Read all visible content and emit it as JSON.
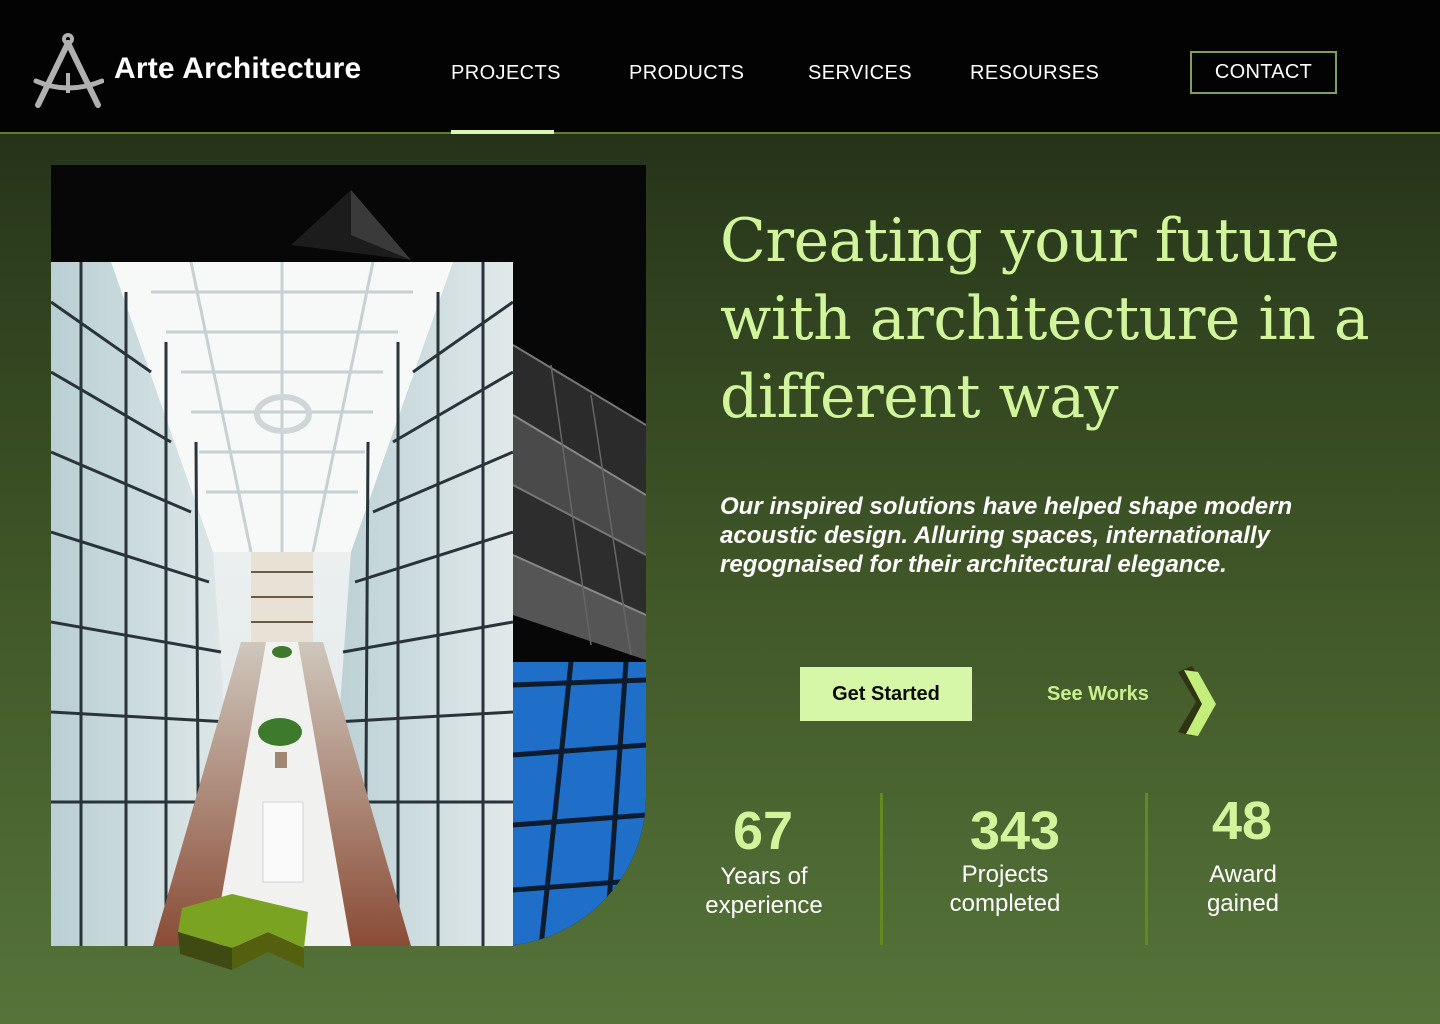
{
  "brand": {
    "name": "Arte Architecture",
    "logo_icon": "drafting-compass-icon"
  },
  "nav": {
    "items": [
      {
        "label": "PROJECTS",
        "active": true
      },
      {
        "label": "PRODUCTS",
        "active": false
      },
      {
        "label": "SERVICES",
        "active": false
      },
      {
        "label": "RESOURSES",
        "active": false
      }
    ],
    "contact_label": "CONTACT"
  },
  "hero": {
    "headline": "Creating your future with architecture in a different way",
    "subtext": "Our inspired solutions have helped shape  modern acoustic design. Alluring spaces, internationally regognaised for their architectural elegance.",
    "primary_cta": "Get Started",
    "secondary_cta": "See Works",
    "secondary_cta_icon": "chevron-right-icon"
  },
  "stats": [
    {
      "value": "67",
      "label": "Years of experience"
    },
    {
      "value": "343",
      "label": "Projects completed"
    },
    {
      "value": "48",
      "label": "Award gained"
    }
  ],
  "colors": {
    "accent": "#d2f59c",
    "button_bg": "#d7f7a8",
    "nav_border": "#5c7f2f",
    "header_bg": "#020302",
    "background_top": "#1b2413",
    "background_bottom": "#56743a"
  }
}
